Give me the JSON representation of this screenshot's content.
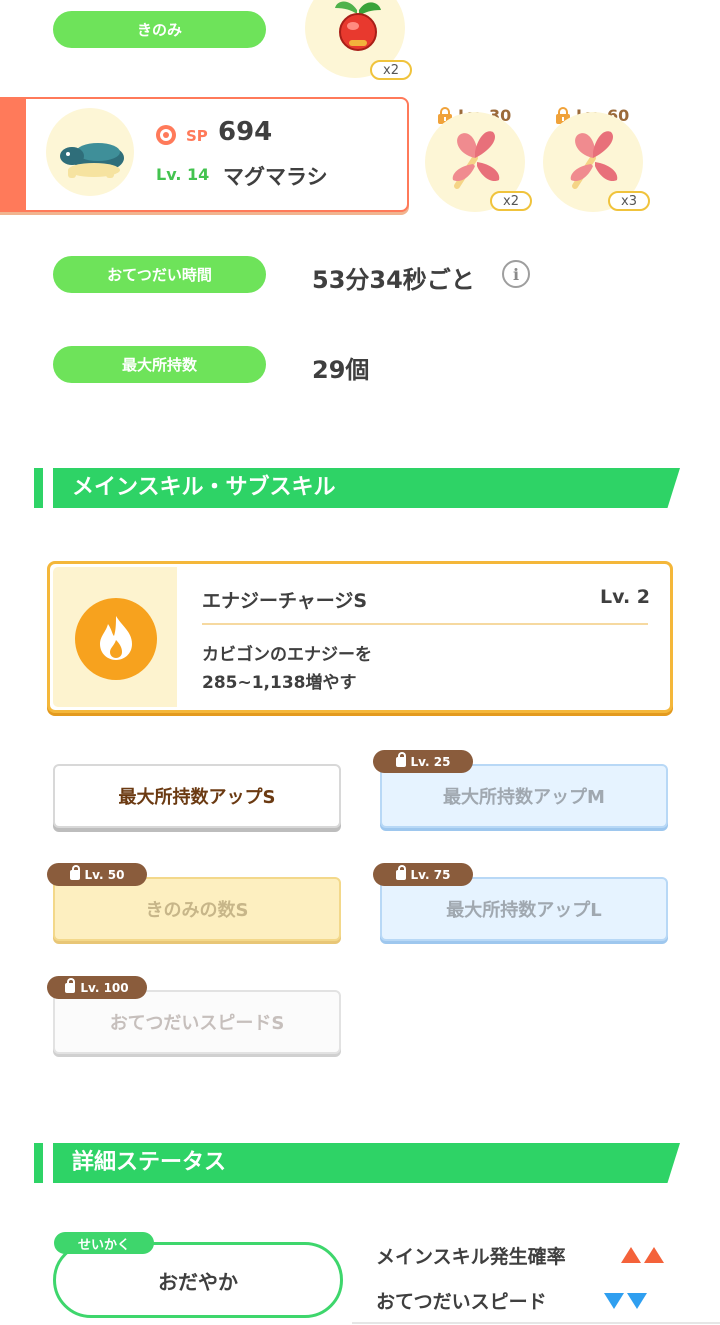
{
  "berry": {
    "label": "きのみ",
    "qty": "x2"
  },
  "pokemon": {
    "sp_label": "SP",
    "sp_value": "694",
    "level": "Lv. 14",
    "name": "マグマラシ"
  },
  "ingredients": [
    {
      "unlock": "Lv. 30",
      "qty": "x2"
    },
    {
      "unlock": "Lv. 60",
      "qty": "x3"
    }
  ],
  "help_time": {
    "label": "おてつだい時間",
    "value": "53分34秒ごと"
  },
  "max_carry": {
    "label": "最大所持数",
    "value": "29個"
  },
  "skills_section": {
    "title": "メインスキル・サブスキル"
  },
  "main_skill": {
    "name": "エナジーチャージS",
    "level": "Lv. 2",
    "desc_line1": "カビゴンのエナジーを",
    "desc_line2": "285~1,138増やす"
  },
  "sub_skills": [
    {
      "label": "最大所持数アップS",
      "unlock": ""
    },
    {
      "label": "最大所持数アップM",
      "unlock": "Lv. 25"
    },
    {
      "label": "きのみの数S",
      "unlock": "Lv. 50"
    },
    {
      "label": "最大所持数アップL",
      "unlock": "Lv. 75"
    },
    {
      "label": "おてつだいスピードS",
      "unlock": "Lv. 100"
    }
  ],
  "status_section": {
    "title": "詳細ステータス"
  },
  "nature": {
    "tag": "せいかく",
    "value": "おだやか",
    "up_label": "メインスキル発生確率",
    "down_label": "おてつだいスピード"
  },
  "colors": {
    "green": "#6ee35a",
    "section_green": "#2ed366",
    "orange_accent": "#ff7a5a",
    "up_arrow": "#f4623a",
    "down_arrow": "#2f9ff0"
  }
}
